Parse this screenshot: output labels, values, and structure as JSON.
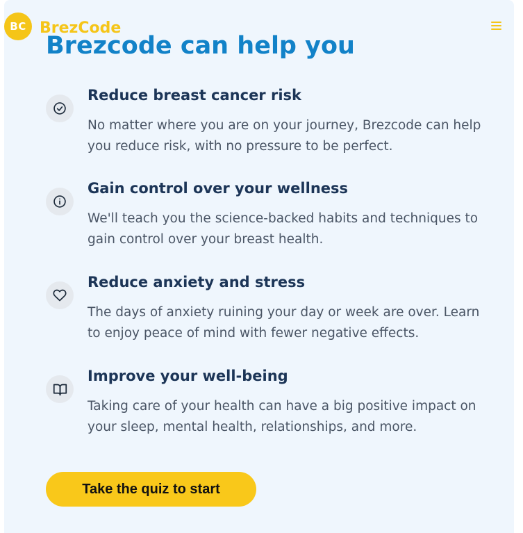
{
  "brand": {
    "badge": "BC",
    "name": "BrezCode"
  },
  "header": {
    "menu_icon": "hamburger-menu-icon"
  },
  "main": {
    "heading": "Brezcode can help you",
    "features": [
      {
        "icon": "check-circle-icon",
        "title": "Reduce breast cancer risk",
        "description": "No matter where you are on your journey, Brezcode can help you reduce risk, with no pressure to be perfect."
      },
      {
        "icon": "info-circle-icon",
        "title": "Gain control over your wellness",
        "description": "We'll teach you the science-backed habits and techniques to gain control over your breast health."
      },
      {
        "icon": "heart-icon",
        "title": "Reduce anxiety and stress",
        "description": "The days of anxiety ruining your day or week are over. Learn to enjoy peace of mind with fewer negative effects."
      },
      {
        "icon": "book-open-icon",
        "title": "Improve your well-being",
        "description": "Taking care of your health can have a big positive impact on your sleep, mental health, relationships, and more."
      }
    ],
    "cta_label": "Take the quiz to start"
  },
  "colors": {
    "brand_yellow": "#f5c518",
    "heading_blue": "#1282c8",
    "title_navy": "#1c3557",
    "body_gray": "#4a5565",
    "card_background": "#eff6fd"
  }
}
